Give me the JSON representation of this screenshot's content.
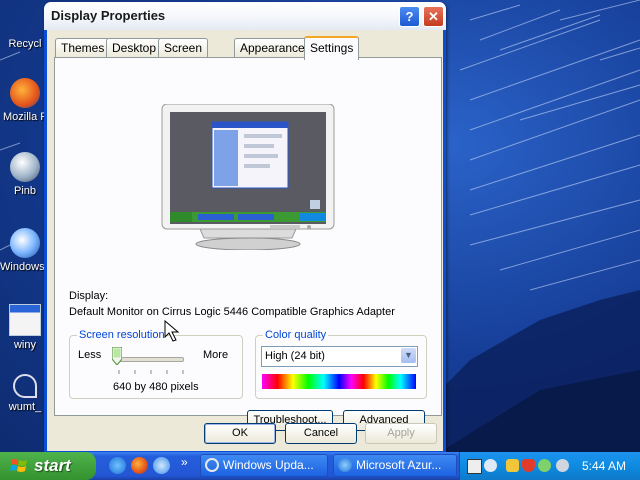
{
  "desktop": {
    "icons": [
      {
        "label": "Recycl",
        "icon": "recycle-bin-icon"
      },
      {
        "label": "Mozilla F",
        "icon": "firefox-icon"
      },
      {
        "label": "Pinb",
        "icon": "pinball-icon"
      },
      {
        "label": "Windows Play",
        "icon": "media-player-icon"
      },
      {
        "label": "winy",
        "icon": "window-app-icon"
      },
      {
        "label": "wumt_",
        "icon": "shortcut-icon"
      }
    ]
  },
  "dialog": {
    "title": "Display Properties",
    "help_label": "?",
    "close_label": "✕",
    "tabs": [
      "Themes",
      "Desktop",
      "Screen Saver",
      "Appearance",
      "Settings"
    ],
    "active_tab": "Settings",
    "display_label": "Display:",
    "adapter": "Default Monitor on Cirrus Logic 5446 Compatible Graphics Adapter",
    "resolution": {
      "legend": "Screen resolution",
      "less": "Less",
      "more": "More",
      "value_text": "640 by 480 pixels",
      "slider_position": 0
    },
    "color": {
      "legend": "Color quality",
      "selected": "High (24 bit)"
    },
    "buttons": {
      "troubleshoot": "Troubleshoot...",
      "advanced": "Advanced",
      "ok": "OK",
      "cancel": "Cancel",
      "apply": "Apply"
    }
  },
  "taskbar": {
    "start_label": "start",
    "quick_launch_more": "»",
    "tasks": [
      {
        "label": "Windows Upda...",
        "icon": "windows-update-icon"
      },
      {
        "label": "Microsoft Azur...",
        "icon": "internet-explorer-icon"
      }
    ],
    "clock": "5:44 AM"
  }
}
